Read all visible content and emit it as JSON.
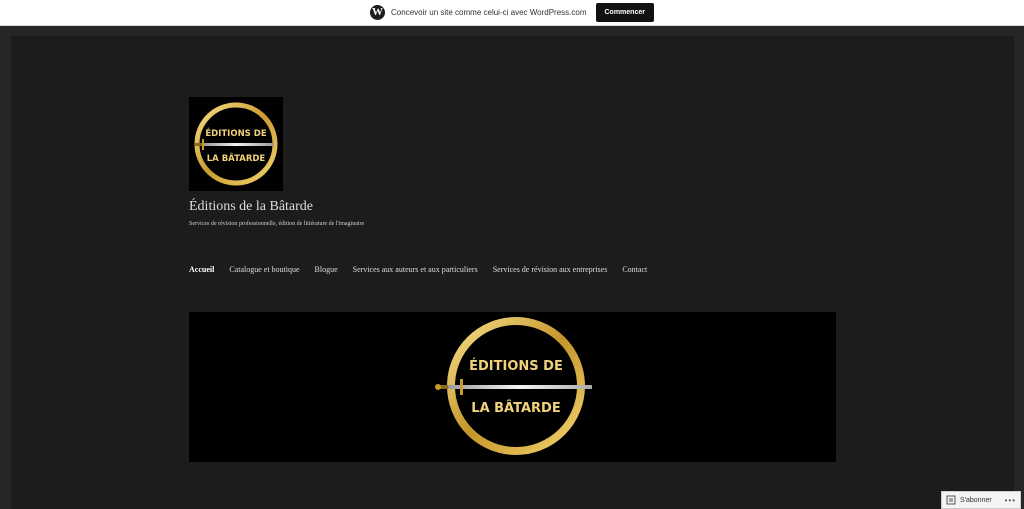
{
  "promo": {
    "icon": "wordpress-icon",
    "text": "Concevoir un site comme celui-ci avec WordPress.com",
    "button": "Commencer"
  },
  "site": {
    "logo_text_top": "ÉDITIONS DE",
    "logo_text_bottom": "LA BÂTARDE",
    "title": "Éditions de la Bâtarde",
    "tagline": "Services de révision professionnelle, édition de littérature de l'imaginaire"
  },
  "nav": {
    "items": [
      {
        "label": "Accueil",
        "active": true
      },
      {
        "label": "Catalogue et boutique",
        "active": false
      },
      {
        "label": "Blogue",
        "active": false
      },
      {
        "label": "Services aux auteurs et aux particuliers",
        "active": false
      },
      {
        "label": "Services de révision aux entreprises",
        "active": false
      },
      {
        "label": "Contact",
        "active": false
      }
    ]
  },
  "subscribe": {
    "label": "S'abonner",
    "more": "•••",
    "icon": "reader-icon"
  },
  "colors": {
    "gold": "#d6ad3a",
    "background": "#1c1c1c"
  }
}
